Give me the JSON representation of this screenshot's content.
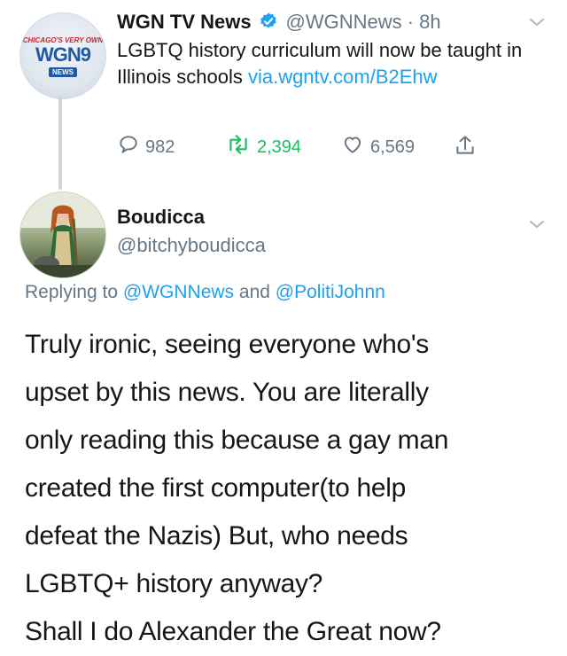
{
  "tweet": {
    "author_name": "WGN TV News",
    "handle_time": "@WGNNews · 8h",
    "text_prefix": "LGBTQ history curriculum will now be taught in Illinois schools ",
    "link": "via.wgntv.com/B2Ehw",
    "avatar_tagline": "CHICAGO'S VERY OWN",
    "avatar_logo": "WGN9",
    "avatar_news": "NEWS",
    "reply_count": "982",
    "retweet_count": "2,394",
    "like_count": "6,569"
  },
  "reply": {
    "author_name": "Boudicca",
    "handle": "@bitchyboudicca",
    "replying_label": "Replying to",
    "replying_to_1": "@WGNNews",
    "replying_and": "and",
    "replying_to_2": "@PolitiJohnn",
    "body_lines": [
      "Truly ironic, seeing everyone who's",
      "upset by this news. You are literally",
      "only reading this because a gay man",
      "created the first computer(to help",
      "defeat the Nazis) But, who needs",
      "LGBTQ+ history anyway?",
      "Shall I do Alexander the Great now?"
    ]
  },
  "colors": {
    "link": "#1da1f2",
    "secondary": "#657786",
    "retweet": "#17bf63",
    "verified": "#1da1f2"
  }
}
